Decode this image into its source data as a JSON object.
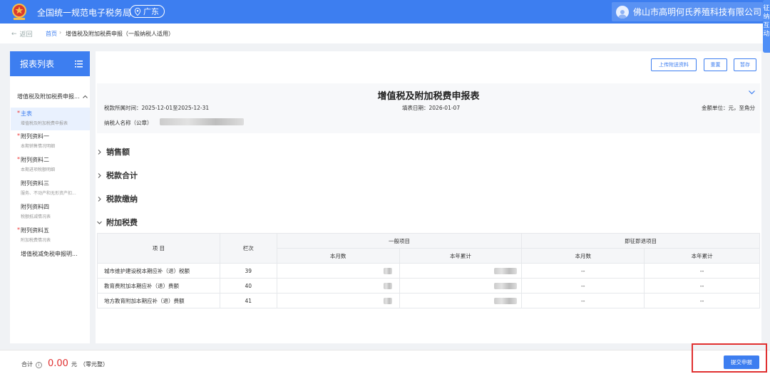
{
  "header": {
    "site_title": "全国统一规范电子税务局",
    "region": "广东",
    "company": "佛山市高明何氏养殖科技有限公司",
    "float_text": "征纳互动"
  },
  "breadcrumb": {
    "back": "返回",
    "home": "首页",
    "sep": "›",
    "current": "增值税及附加税费申报（一般纳税人适用）"
  },
  "sidebar": {
    "title": "报表列表",
    "group": "增值税及附加税费申报...",
    "items": [
      {
        "title": "主表",
        "sub": "增值税及附加税费申报表",
        "required": "*"
      },
      {
        "title": "附列资料一",
        "sub": "本期销售情况明细",
        "required": "*"
      },
      {
        "title": "附列资料二",
        "sub": "本期进项税额明细",
        "required": "*"
      },
      {
        "title": "附列资料三",
        "sub": "服务、不动产和无形资产扣...",
        "required": ""
      },
      {
        "title": "附列资料四",
        "sub": "税额抵减情况表",
        "required": ""
      },
      {
        "title": "附列资料五",
        "sub": "附加税费情况表",
        "required": "*"
      },
      {
        "title": "增值税减免税申报明...",
        "sub": "",
        "required": ""
      }
    ]
  },
  "toolbar": {
    "upload": "上传附送资料",
    "reset": "重置",
    "save": "暂存"
  },
  "form": {
    "title": "增值税及附加税费申报表",
    "period": "税款所属时间：2025-12-01至2025-12-31",
    "fill_date": "填表日期：2026-01-07",
    "unit": "金额单位：元，至角分",
    "taxpayer_label": "纳税人名称（公章）"
  },
  "sections": {
    "sales": "销售额",
    "tax_total": "税款合计",
    "tax_paid": "税款缴纳",
    "surtax": "附加税费"
  },
  "table": {
    "h_item": "项 目",
    "h_col": "栏次",
    "h_general": "一般项目",
    "h_refund": "即征即退项目",
    "h_month": "本月数",
    "h_year": "本年累计",
    "rows": [
      {
        "name": "城市维护建设税本期应补（退）税额",
        "col": "39",
        "r_month": "--",
        "r_year": "--"
      },
      {
        "name": "教育费附加本期应补（退）费额",
        "col": "40",
        "r_month": "--",
        "r_year": "--"
      },
      {
        "name": "地方教育附加本期应补（退）费额",
        "col": "41",
        "r_month": "--",
        "r_year": "--"
      }
    ]
  },
  "footer": {
    "total_label": "合计",
    "info": "i",
    "total_amount": "0.00",
    "currency": "元",
    "chinese": "（零元整）",
    "submit": "提交申报"
  },
  "colors": {
    "primary": "#3d7ef0",
    "danger": "#e03030"
  }
}
